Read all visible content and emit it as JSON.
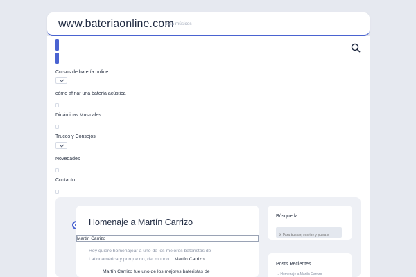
{
  "header": {
    "site_title": "www.bateriaonline.com",
    "tagline": "para músicos"
  },
  "search": {
    "button_icon": "search-icon"
  },
  "menu": {
    "items": [
      {
        "label": "Cursos de batería online",
        "has_submenu": true
      },
      {
        "label": "cómo afinar una batería acústica",
        "has_submenu": false
      },
      {
        "label": "Dinámicas Musicales",
        "has_submenu": false
      },
      {
        "label": "Trucos y Consejos",
        "has_submenu": true
      },
      {
        "label": "Novedades",
        "has_submenu": false
      },
      {
        "label": "Contacto",
        "has_submenu": false
      }
    ]
  },
  "post": {
    "title": "Homenaje a Martín Carrizo",
    "author": "Martín Carrizo",
    "excerpt": "Hoy quiero homenajear a uno de los mejores bateristas de Latinoamérica y porqué no, del mundo...",
    "excerpt_link": "Martín Carrizo",
    "lead": "Martín Carrizo fue uno de los mejores bateristas de"
  },
  "sidebar": {
    "search_widget": {
      "title": "Búsqueda",
      "placeholder": "⟳ Para buscar, escribe y pulsa e"
    },
    "recent_widget": {
      "title": "Posts Recientes",
      "first_item": "→ Homenaje a Martín Carrizo"
    }
  },
  "colors": {
    "accent": "#4a63d1",
    "page_bg": "#e6e9f0",
    "card_bg": "#ffffff",
    "text": "#2b3445",
    "muted": "#8a93a5"
  }
}
